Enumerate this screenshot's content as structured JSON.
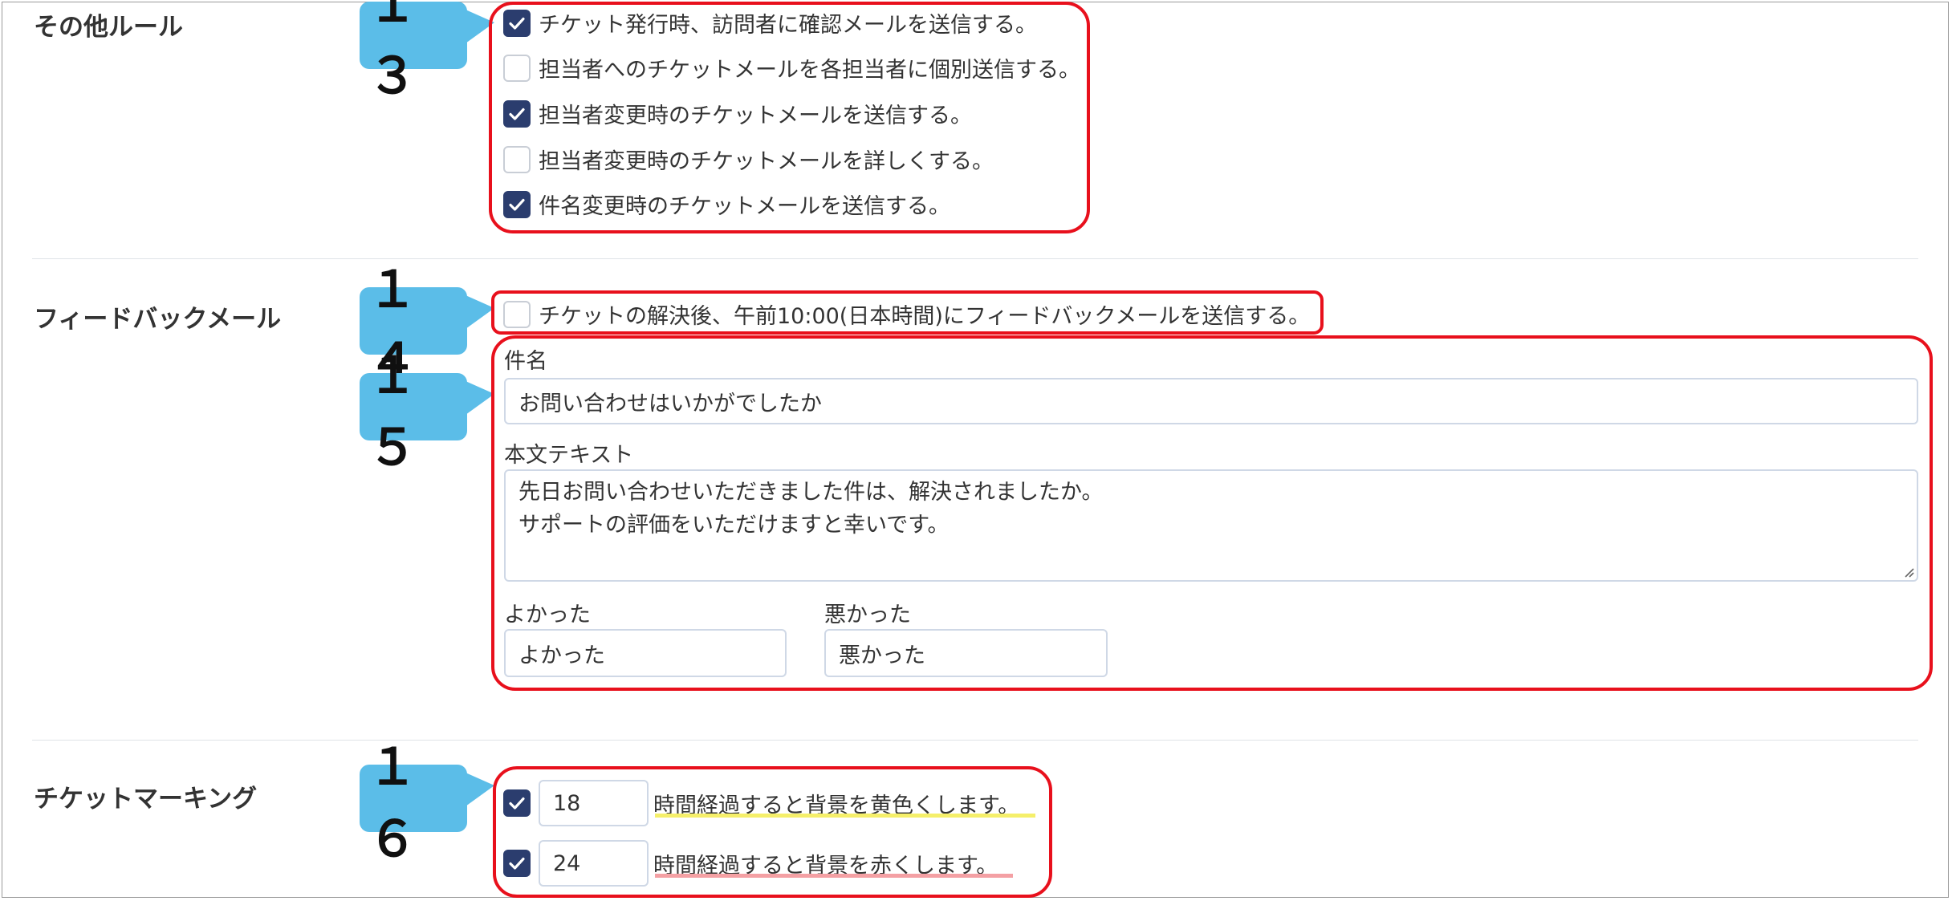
{
  "colors": {
    "badge": "#5bbde8",
    "highlight_border": "#e8101c",
    "checkbox_checked": "#2b3d6e",
    "underline_yellow": "#f5ef6a",
    "underline_red": "#f4a0a4"
  },
  "other_rules": {
    "title": "その他ルール",
    "badge": "１３",
    "options": [
      {
        "label": "チケット発行時、訪問者に確認メールを送信する。",
        "checked": true
      },
      {
        "label": "担当者へのチケットメールを各担当者に個別送信する。",
        "checked": false
      },
      {
        "label": "担当者変更時のチケットメールを送信する。",
        "checked": true
      },
      {
        "label": "担当者変更時のチケットメールを詳しくする。",
        "checked": false
      },
      {
        "label": "件名変更時のチケットメールを送信する。",
        "checked": true
      }
    ]
  },
  "feedback_mail": {
    "title": "フィードバックメール",
    "badge_send": "１４",
    "send_option": {
      "label": "チケットの解決後、午前10:00(日本時間)にフィードバックメールを送信する。",
      "checked": false
    },
    "badge_form": "１５",
    "subject_label": "件名",
    "subject_value": "お問い合わせはいかがでしたか",
    "body_label": "本文テキスト",
    "body_lines": [
      "先日お問い合わせいただきました件は、解決されましたか。",
      "サポートの評価をいただけますと幸いです。"
    ],
    "good_label": "よかった",
    "good_value": "よかった",
    "bad_label": "悪かった",
    "bad_value": "悪かった"
  },
  "ticket_marking": {
    "title": "チケットマーキング",
    "badge": "１６",
    "rules": [
      {
        "hours": "18",
        "label": "時間経過すると背景を黄色くします。",
        "checked": true
      },
      {
        "hours": "24",
        "label": "時間経過すると背景を赤くします。",
        "checked": true
      }
    ]
  }
}
